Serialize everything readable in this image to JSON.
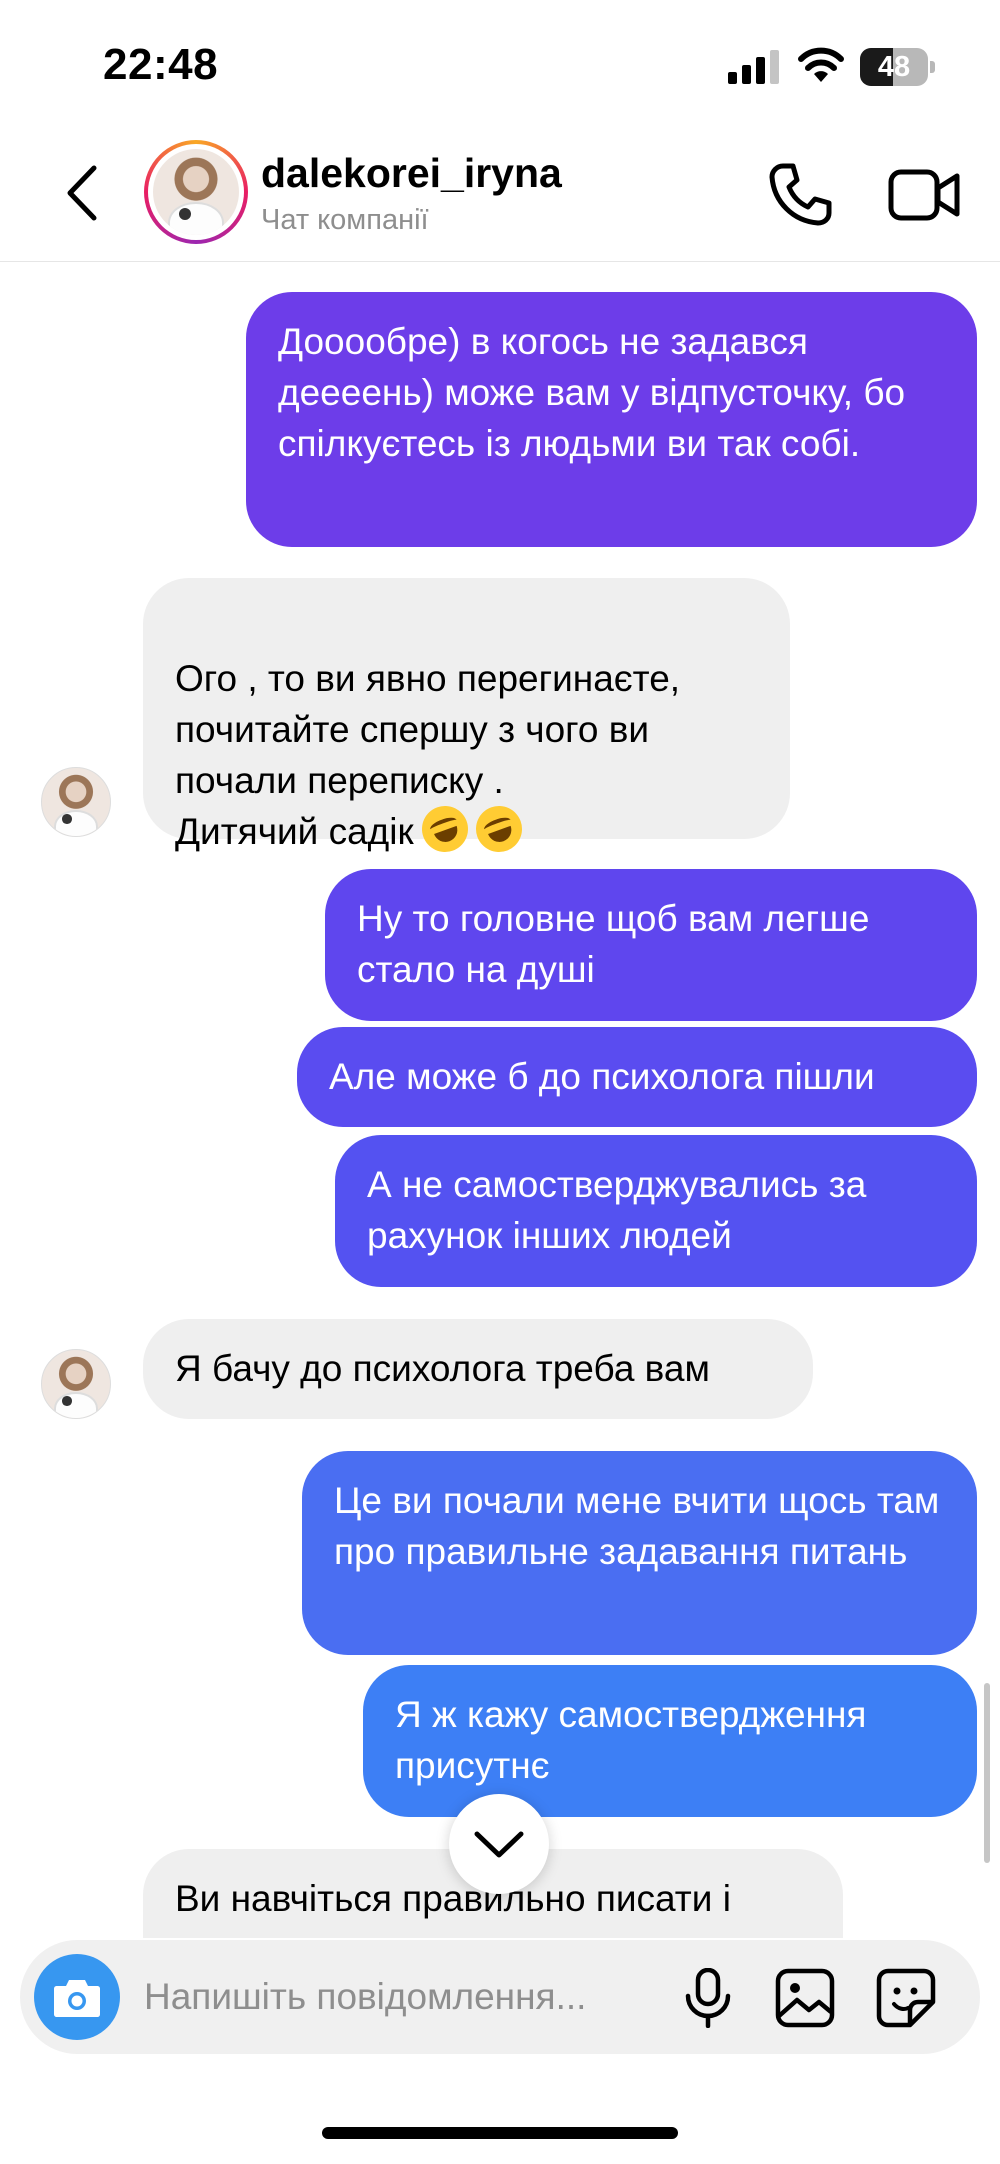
{
  "status_bar": {
    "time": "22:48",
    "battery": "48",
    "battery_level": 0.48
  },
  "header": {
    "back_icon": "chevron-left-icon",
    "username": "dalekorei_iryna",
    "subtitle": "Чат компанії",
    "call_icon": "phone-icon",
    "video_icon": "video-camera-icon"
  },
  "messages": [
    {
      "direction": "out",
      "text": "Дооообре) в когось не задався деееень) може вам у відпусточку, бо спілкуєтесь із людьми ви так собі."
    },
    {
      "direction": "in",
      "text": "Ого , то ви явно перегинаєте, почитайте спершу з чого ви почали переписку .\nДитячий садік",
      "emoji": "rolling-on-floor-laughing"
    },
    {
      "direction": "out",
      "text": "Ну то головне щоб вам легше стало на душі"
    },
    {
      "direction": "out",
      "text": "Але може б до психолога пішли"
    },
    {
      "direction": "out",
      "text": "А не самостверджувались за рахунок інших людей"
    },
    {
      "direction": "in",
      "text": "Я бачу до психолога треба вам"
    },
    {
      "direction": "out",
      "text": "Це ви почали мене вчити щось там про правильне задавання питань"
    },
    {
      "direction": "out",
      "text": "Я ж кажу самоствердження присутнє"
    },
    {
      "direction": "in",
      "text": "Ви навчіться правильно писати і"
    }
  ],
  "composer": {
    "placeholder": "Напишіть повідомлення...",
    "camera_icon": "camera-icon",
    "mic_icon": "microphone-icon",
    "gallery_icon": "image-icon",
    "sticker_icon": "sticker-icon"
  },
  "colors": {
    "gradient_top": "#7c3aed",
    "gradient_mid": "#5a4cf0",
    "gradient_bottom": "#3b82f6",
    "incoming_bg": "#efefef",
    "accent": "#3797f0"
  }
}
